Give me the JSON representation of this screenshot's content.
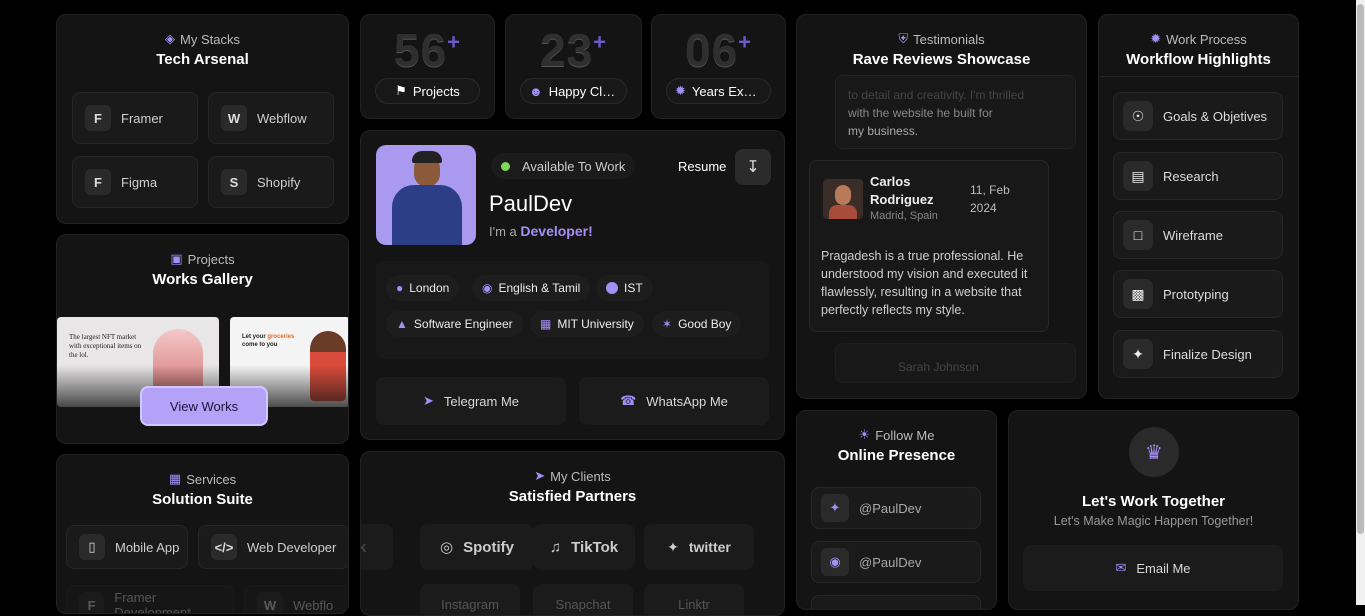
{
  "stacks": {
    "eyebrow": "My Stacks",
    "title": "Tech Arsenal",
    "items": [
      {
        "label": "Framer",
        "icon": "framer-icon"
      },
      {
        "label": "Webflow",
        "icon": "webflow-icon"
      },
      {
        "label": "Figma",
        "icon": "figma-icon"
      },
      {
        "label": "Shopify",
        "icon": "shopify-icon"
      }
    ]
  },
  "projects": {
    "eyebrow": "Projects",
    "title": "Works Gallery",
    "thumb1": "The largest NFT market with exceptional items on the lol.",
    "thumb2a": "Let your",
    "thumb2b": "groceries",
    "thumb2c": "come to you",
    "button": "View Works"
  },
  "services": {
    "eyebrow": "Services",
    "title": "Solution Suite",
    "items": [
      "Mobile App",
      "Web Developer"
    ],
    "row2": [
      "Framer Development",
      "Webflo"
    ]
  },
  "stats": [
    {
      "num": "56",
      "plus": "+",
      "label": "Projects"
    },
    {
      "num": "23",
      "plus": "+",
      "label": "Happy Clie..."
    },
    {
      "num": "06",
      "plus": "+",
      "label": "Years Exper..."
    }
  ],
  "profile": {
    "status": "Available To Work",
    "resume": "Resume",
    "name": "PaulDev",
    "im": "I'm a",
    "role": "Developer!",
    "tags": [
      "London",
      "English & Tamil",
      "IST",
      "Software Engineer",
      "MIT University",
      "Good Boy"
    ],
    "telegram": "Telegram Me",
    "whatsapp": "WhatsApp Me",
    "status_color": "#7ed957"
  },
  "clients": {
    "eyebrow": "My Clients",
    "title": "Satisfied Partners",
    "logos": [
      "k",
      "Spotify",
      "TikTok",
      "twitter"
    ],
    "row2": [
      "Instagram",
      "Snapchat",
      "Linktr"
    ]
  },
  "testimonials": {
    "eyebrow": "Testimonials",
    "title": "Rave Reviews Showcase",
    "prev_text1": "to detail and creativity. I'm thrilled",
    "prev_text2": "with the website he built for",
    "prev_text3": "my business.",
    "name1": "Carlos",
    "name2": "Rodriguez",
    "location": "Madrid, Spain",
    "date1": "11, Feb",
    "date2": "2024",
    "quote": "Pragadesh is a true professional. He understood my vision and executed it flawlessly, resulting in a website that perfectly reflects my style.",
    "next_name": "Sarah Johnson"
  },
  "process": {
    "eyebrow": "Work Process",
    "title": "Workflow Highlights",
    "steps": [
      "Goals & Objetives",
      "Research",
      "Wireframe",
      "Prototyping",
      "Finalize Design"
    ]
  },
  "follow": {
    "eyebrow": "Follow Me",
    "title": "Online Presence",
    "handles": [
      "@PaulDev",
      "@PaulDev"
    ]
  },
  "cta": {
    "title": "Let's Work Together",
    "subtitle": "Let's Make Magic Happen Together!",
    "button": "Email Me"
  },
  "accent": "#a48ff5"
}
